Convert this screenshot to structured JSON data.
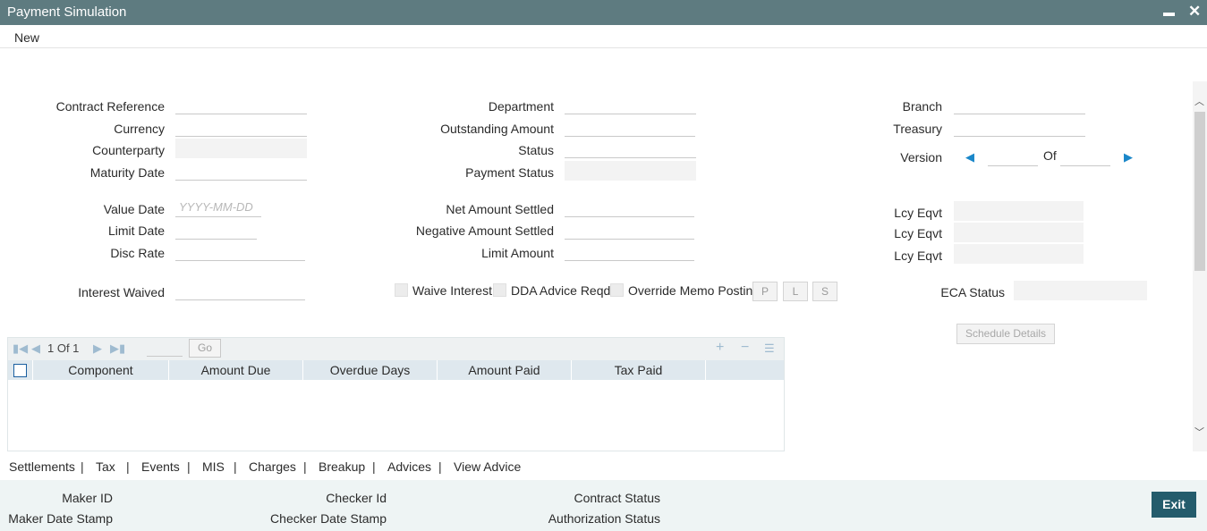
{
  "window": {
    "title": "Payment Simulation",
    "minimize": "▬",
    "close": "✕"
  },
  "menu": {
    "new": "New"
  },
  "fields": {
    "contract_reference": {
      "label": "Contract Reference",
      "value": ""
    },
    "currency": {
      "label": "Currency",
      "value": ""
    },
    "counterparty": {
      "label": "Counterparty",
      "value": ""
    },
    "maturity_date": {
      "label": "Maturity Date",
      "value": ""
    },
    "value_date": {
      "label": "Value Date",
      "value": "",
      "placeholder": "YYYY-MM-DD"
    },
    "limit_date": {
      "label": "Limit Date",
      "value": ""
    },
    "disc_rate": {
      "label": "Disc Rate",
      "value": ""
    },
    "interest_waived": {
      "label": "Interest Waived",
      "value": ""
    },
    "department": {
      "label": "Department",
      "value": ""
    },
    "outstanding_amount": {
      "label": "Outstanding Amount",
      "value": ""
    },
    "status": {
      "label": "Status",
      "value": ""
    },
    "payment_status": {
      "label": "Payment Status",
      "value": ""
    },
    "net_amount_settled": {
      "label": "Net Amount Settled",
      "value": ""
    },
    "negative_amount_settled": {
      "label": "Negative Amount Settled",
      "value": ""
    },
    "limit_amount": {
      "label": "Limit Amount",
      "value": ""
    },
    "branch": {
      "label": "Branch",
      "value": ""
    },
    "treasury": {
      "label": "Treasury",
      "value": ""
    },
    "version": {
      "label": "Version",
      "value": "",
      "of_label": "Of",
      "of_value": ""
    },
    "lcy_eqvt_1": {
      "label": "Lcy Eqvt",
      "value": ""
    },
    "lcy_eqvt_2": {
      "label": "Lcy Eqvt",
      "value": ""
    },
    "lcy_eqvt_3": {
      "label": "Lcy Eqvt",
      "value": ""
    },
    "eca_status": {
      "label": "ECA Status",
      "value": ""
    }
  },
  "checkboxes": {
    "waive_interest": "Waive Interest",
    "dda_advice_reqd": "DDA Advice Reqd",
    "override_memo_posting": "Override Memo Posting"
  },
  "mini_buttons": {
    "p": "P",
    "l": "L",
    "s": "S"
  },
  "schedule_button": "Schedule Details",
  "grid": {
    "pagination": "1 Of 1",
    "go": "Go",
    "columns": [
      "Component",
      "Amount Due",
      "Overdue Days",
      "Amount Paid",
      "Tax Paid"
    ],
    "rows": []
  },
  "tabs": [
    "Settlements",
    "Tax",
    "Events",
    "MIS",
    "Charges",
    "Breakup",
    "Advices",
    "View Advice"
  ],
  "footer": {
    "maker_id": "Maker ID",
    "maker_date_stamp": "Maker Date Stamp",
    "checker_id": "Checker Id",
    "checker_date_stamp": "Checker Date Stamp",
    "contract_status": "Contract Status",
    "authorization_status": "Authorization Status",
    "exit": "Exit"
  },
  "colors": {
    "titlebar": "#5e7b80",
    "accent": "#1a87c9",
    "exit_button": "#245c6c",
    "grid_header": "#dfe8ee"
  }
}
